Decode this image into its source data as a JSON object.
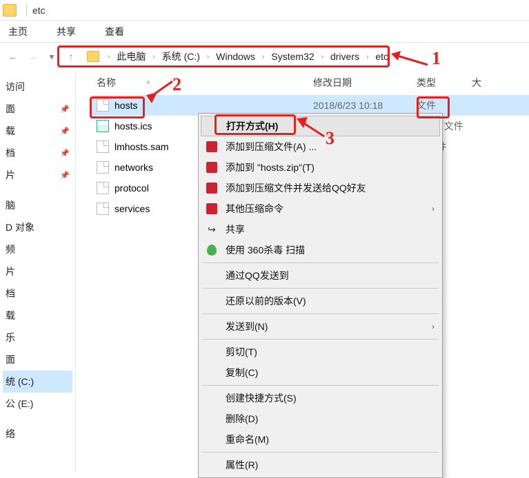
{
  "window": {
    "title": "etc"
  },
  "tabs": {
    "home": "主页",
    "share": "共享",
    "view": "查看"
  },
  "breadcrumb": {
    "parts": [
      "此电脑",
      "系统 (C:)",
      "Windows",
      "System32",
      "drivers",
      "etc"
    ]
  },
  "columns": {
    "name": "名称",
    "date": "修改日期",
    "type": "类型",
    "ext": "大"
  },
  "sidebar": {
    "items": [
      {
        "label": "访问"
      },
      {
        "label": "面"
      },
      {
        "label": "载"
      },
      {
        "label": "档"
      },
      {
        "label": "片"
      },
      {
        "label": ""
      },
      {
        "label": "脑"
      },
      {
        "label": "D 对象"
      },
      {
        "label": "频"
      },
      {
        "label": "片"
      },
      {
        "label": "档"
      },
      {
        "label": "载"
      },
      {
        "label": "乐"
      },
      {
        "label": "面"
      },
      {
        "label": "统 (C:)"
      },
      {
        "label": "公 (E:)"
      },
      {
        "label": ""
      },
      {
        "label": "络"
      }
    ]
  },
  "files": [
    {
      "name": "hosts",
      "date": "2018/6/23 10:18",
      "type": "文件",
      "icon": "file"
    },
    {
      "name": "hosts.ics",
      "date": "",
      "type": "endar 文件",
      "icon": "cal"
    },
    {
      "name": "lmhosts.sam",
      "date": "",
      "type": "M 文件",
      "icon": "file"
    },
    {
      "name": "networks",
      "date": "",
      "type": "",
      "icon": "file"
    },
    {
      "name": "protocol",
      "date": "",
      "type": "",
      "icon": "file"
    },
    {
      "name": "services",
      "date": "",
      "type": "",
      "icon": "file"
    }
  ],
  "context_menu": {
    "open_with": "打开方式(H)",
    "add_archive": "添加到压缩文件(A) ...",
    "add_hosts_zip": "添加到 \"hosts.zip\"(T)",
    "add_send_qq": "添加到压缩文件并发送给QQ好友",
    "other_zip": "其他压缩命令",
    "share": "共享",
    "scan_360": "使用 360杀毒 扫描",
    "send_qq": "通过QQ发送到",
    "restore_prev": "还原以前的版本(V)",
    "send_to": "发送到(N)",
    "cut": "剪切(T)",
    "copy": "复制(C)",
    "shortcut": "创建快捷方式(S)",
    "delete": "删除(D)",
    "rename": "重命名(M)",
    "properties": "属性(R)"
  },
  "annotations": {
    "one": "1",
    "two": "2",
    "three": "3"
  }
}
